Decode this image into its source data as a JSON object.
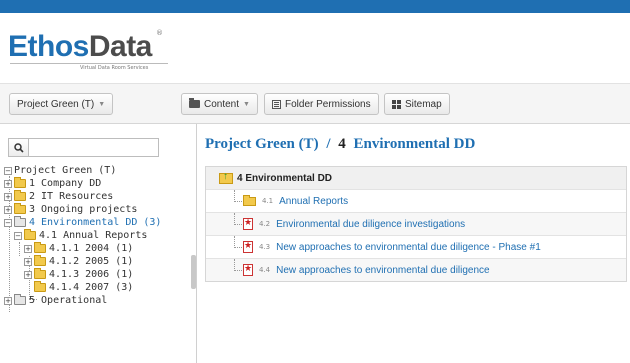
{
  "logo": {
    "part1": "Ethos",
    "part2": "Data",
    "reg": "®",
    "tagline": "Virtual Data Room Services"
  },
  "toolbar": {
    "project_label": "Project Green (T)",
    "content_label": "Content",
    "folder_permissions_label": "Folder Permissions",
    "sitemap_label": "Sitemap"
  },
  "search": {
    "placeholder": ""
  },
  "tree": {
    "root": "Project Green (T)",
    "items": [
      {
        "label": "1 Company DD"
      },
      {
        "label": "2 IT Resources"
      },
      {
        "label": "3 Ongoing projects"
      },
      {
        "label": "4 Environmental DD (3)"
      },
      {
        "label": "4.1 Annual Reports"
      },
      {
        "label": "4.1.1 2004 (1)"
      },
      {
        "label": "4.1.2 2005 (1)"
      },
      {
        "label": "4.1.3 2006 (1)"
      },
      {
        "label": "4.1.4 2007 (3)"
      },
      {
        "label": "5 Operational"
      }
    ]
  },
  "breadcrumb": {
    "project": "Project Green (T)",
    "separator": "/",
    "current_number": "4",
    "current_name": "Environmental DD"
  },
  "table": {
    "header": "4 Environmental DD",
    "rows": [
      {
        "number": "4.1",
        "label": "Annual Reports",
        "type": "folder"
      },
      {
        "number": "4.2",
        "label": "Environmental due diligence investigations",
        "type": "pdf"
      },
      {
        "number": "4.3",
        "label": "New approaches to environmental due diligence - Phase #1",
        "type": "pdf"
      },
      {
        "number": "4.4",
        "label": "New approaches to environmental due diligence",
        "type": "pdf"
      }
    ]
  },
  "colors": {
    "brand_blue": "#1f6fb2",
    "folder_yellow": "#f2c94c",
    "pdf_red": "#cc2222"
  }
}
